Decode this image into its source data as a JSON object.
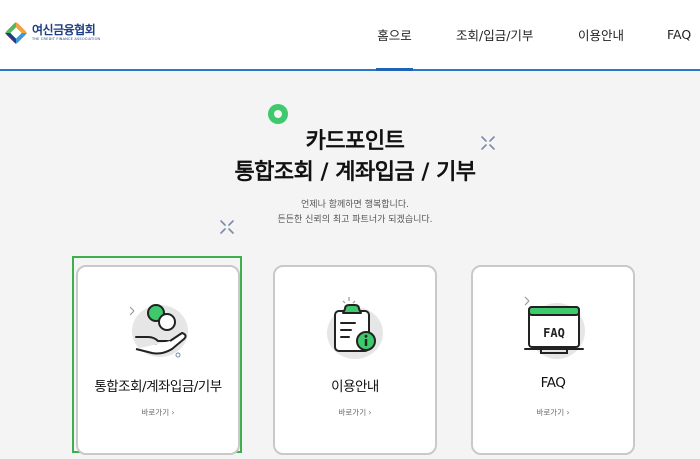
{
  "brand": {
    "name_ko": "여신금융협회",
    "name_en": "THE CREDIT FINANCE ASSOCIATION"
  },
  "nav": {
    "items": [
      {
        "label": "홈으로",
        "active": true
      },
      {
        "label": "조회/입금/기부",
        "active": false
      },
      {
        "label": "이용안내",
        "active": false
      },
      {
        "label": "FAQ",
        "active": false
      }
    ]
  },
  "hero": {
    "title_line1": "카드포인트",
    "title_line2": "통합조회 / 계좌입금 / 기부",
    "subtitle_line1": "언제나 함께하면 행복합니다.",
    "subtitle_line2": "든든한 신뢰의 최고 파트너가 되겠습니다."
  },
  "cards": [
    {
      "title": "통합조회/계좌입금/기부",
      "link": "바로가기 ›",
      "icon": "hand-coins-icon"
    },
    {
      "title": "이용안내",
      "link": "바로가기 ›",
      "icon": "clipboard-info-icon"
    },
    {
      "title": "FAQ",
      "link": "바로가기 ›",
      "icon": "faq-screen-icon"
    }
  ],
  "colors": {
    "accent": "#1f63b6",
    "green": "#3ec96c",
    "focus": "#3fae4f",
    "card_border": "#c9c9c9",
    "background": "#f4f4f4"
  }
}
